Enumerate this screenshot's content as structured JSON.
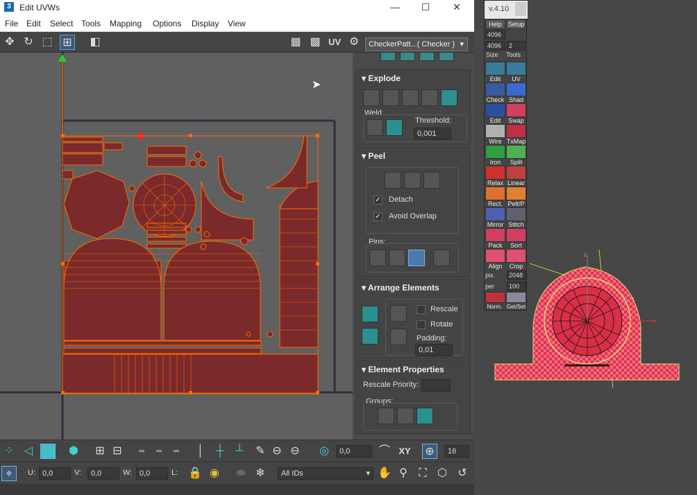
{
  "window": {
    "title": "Edit UVWs",
    "minimize": "—",
    "maximize": "☐",
    "close": "✕",
    "app_icon": "3"
  },
  "menu": [
    "File",
    "Edit",
    "Select",
    "Tools",
    "Mapping",
    "Options",
    "Display",
    "View"
  ],
  "toolbar": {
    "uv_label": "UV",
    "checker_dropdown": "CheckerPatt...( Checker )"
  },
  "panel": {
    "explode": {
      "title": "Explode",
      "weld_label": "Weld",
      "threshold_label": "Threshold:",
      "threshold_value": "0,001"
    },
    "peel": {
      "title": "Peel",
      "detach_label": "Detach",
      "avoid_overlap_label": "Avoid Overlap",
      "pins_label": "Pins:"
    },
    "arrange": {
      "title": "Arrange Elements",
      "rescale_label": "Rescale",
      "rotate_label": "Rotate",
      "padding_label": "Padding:",
      "padding_value": "0,01"
    },
    "element_props": {
      "title": "Element Properties",
      "rescale_priority_label": "Rescale Priority:",
      "groups_label": "Groups:"
    }
  },
  "bottom": {
    "offset_value": "0,0",
    "xy_label": "XY",
    "grid_value": "16",
    "u_label": "U:",
    "u_value": "0,0",
    "v_label": "V:",
    "v_value": "0,0",
    "w_label": "W:",
    "w_value": "0,0",
    "l_label": "L:",
    "ids_value": "All IDs"
  },
  "texture_tools": {
    "version": "v.4.10",
    "help": "Help",
    "setup": "Setup",
    "size_a": "4096",
    "size_b": "4096",
    "size_c": "2",
    "size_label": "Size",
    "tools_label": "Tools",
    "buttons": [
      [
        "Edit",
        "UV"
      ],
      [
        "Check",
        "Shad"
      ],
      [
        "Edit",
        "Swap"
      ],
      [
        "Wire",
        "TxMap"
      ],
      [
        "Iron",
        "Split"
      ],
      [
        "Relax",
        "Linear"
      ],
      [
        "Rect.",
        "Pelt/P"
      ],
      [
        "Mirror",
        "Stitch"
      ],
      [
        "Pack",
        "Sort"
      ],
      [
        "Align",
        "Crop"
      ]
    ],
    "pix_label": "pix.",
    "pix_value": "2048",
    "per_label": "per",
    "per_value": "100",
    "bottom_label": "Norm.",
    "bottom_label2": "Get/Set"
  },
  "colors": {
    "uv_fill": "#7a2a2a",
    "uv_line": "#ff6a00",
    "viewport_bg": "#606060",
    "panel_bg": "#444444"
  }
}
